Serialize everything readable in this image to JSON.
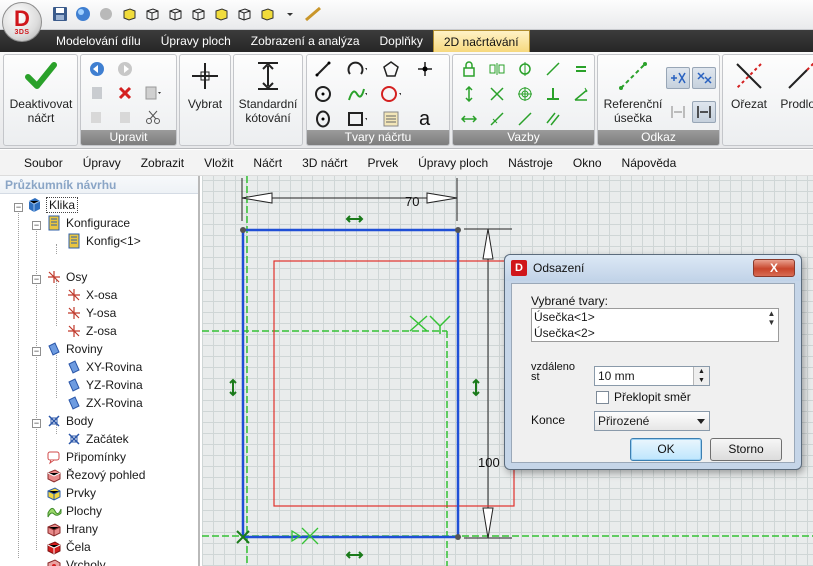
{
  "app": {
    "logo_letter": "D",
    "logo_sub": "3DS"
  },
  "quick_access": [
    "save-icon",
    "globe-icon",
    "circle-icon",
    "cube-icon-1",
    "cube-icon-2",
    "cube-icon-3",
    "cube-icon-4",
    "cube-icon-5",
    "cube-icon-6",
    "cube-icon-7"
  ],
  "ribbon_tabs": [
    {
      "label": "Modelování dílu",
      "active": false
    },
    {
      "label": "Úpravy ploch",
      "active": false
    },
    {
      "label": "Zobrazení a analýza",
      "active": false
    },
    {
      "label": "Doplňky",
      "active": false
    },
    {
      "label": "2D načrtávání",
      "active": true
    }
  ],
  "ribbon": {
    "deactivate_label_1": "Deaktivovat",
    "deactivate_label_2": "náčrt",
    "edit_group": "Upravit",
    "select_label": "Vybrat",
    "dim_label_1": "Standardní",
    "dim_label_2": "kótování",
    "shapes_group": "Tvary náčrtu",
    "constraints_group": "Vazby",
    "ref_label_1": "Referenční",
    "ref_label_2": "úsečka",
    "offset_group": "Odkaz",
    "trim_label": "Ořezat",
    "extend_label": "Prodlou"
  },
  "menu": [
    "Soubor",
    "Úpravy",
    "Zobrazit",
    "Vložit",
    "Náčrt",
    "3D náčrt",
    "Prvek",
    "Úpravy ploch",
    "Nástroje",
    "Okno",
    "Nápověda"
  ],
  "explorer": {
    "title": "Průzkumník návrhu",
    "items": [
      {
        "label": "Klika",
        "icon": "part-icon"
      },
      {
        "label": "Konfigurace",
        "icon": "config-icon"
      },
      {
        "label": "Konfig<1>",
        "icon": "config-icon"
      },
      {
        "label": "Osy",
        "icon": "axes-icon"
      },
      {
        "label": "X-osa",
        "icon": "axis-icon"
      },
      {
        "label": "Y-osa",
        "icon": "axis-icon"
      },
      {
        "label": "Z-osa",
        "icon": "axis-icon"
      },
      {
        "label": "Roviny",
        "icon": "planes-icon"
      },
      {
        "label": "XY-Rovina",
        "icon": "plane-icon"
      },
      {
        "label": "YZ-Rovina",
        "icon": "plane-icon"
      },
      {
        "label": "ZX-Rovina",
        "icon": "plane-icon"
      },
      {
        "label": "Body",
        "icon": "points-icon"
      },
      {
        "label": "Začátek",
        "icon": "origin-icon"
      },
      {
        "label": "Připomínky",
        "icon": "notes-icon"
      },
      {
        "label": "Řezový pohled",
        "icon": "section-icon"
      },
      {
        "label": "Prvky",
        "icon": "features-icon"
      },
      {
        "label": "Plochy",
        "icon": "surfaces-icon"
      },
      {
        "label": "Hrany",
        "icon": "edges-icon"
      },
      {
        "label": "Čela",
        "icon": "faces-icon"
      },
      {
        "label": "Vrcholy",
        "icon": "vertices-icon"
      }
    ]
  },
  "canvas": {
    "dim_width": "70",
    "dim_height": "100",
    "colors": {
      "sketch": "#1f4fd6",
      "offset": "#e0312c",
      "axis": "#34c234",
      "grid": "#cfd6d6"
    }
  },
  "dialog": {
    "title": "Odsazení",
    "close": "X",
    "selected_label": "Vybrané tvary:",
    "selected_items": [
      "Úsečka<1>",
      "Úsečka<2>"
    ],
    "distance_label_1": "vzdáleno",
    "distance_label_2": "st",
    "distance_value": "10 mm",
    "flip_label": "Překlopit směr",
    "ends_label": "Konce",
    "ends_value": "Přirozené",
    "ok": "OK",
    "cancel": "Storno"
  }
}
